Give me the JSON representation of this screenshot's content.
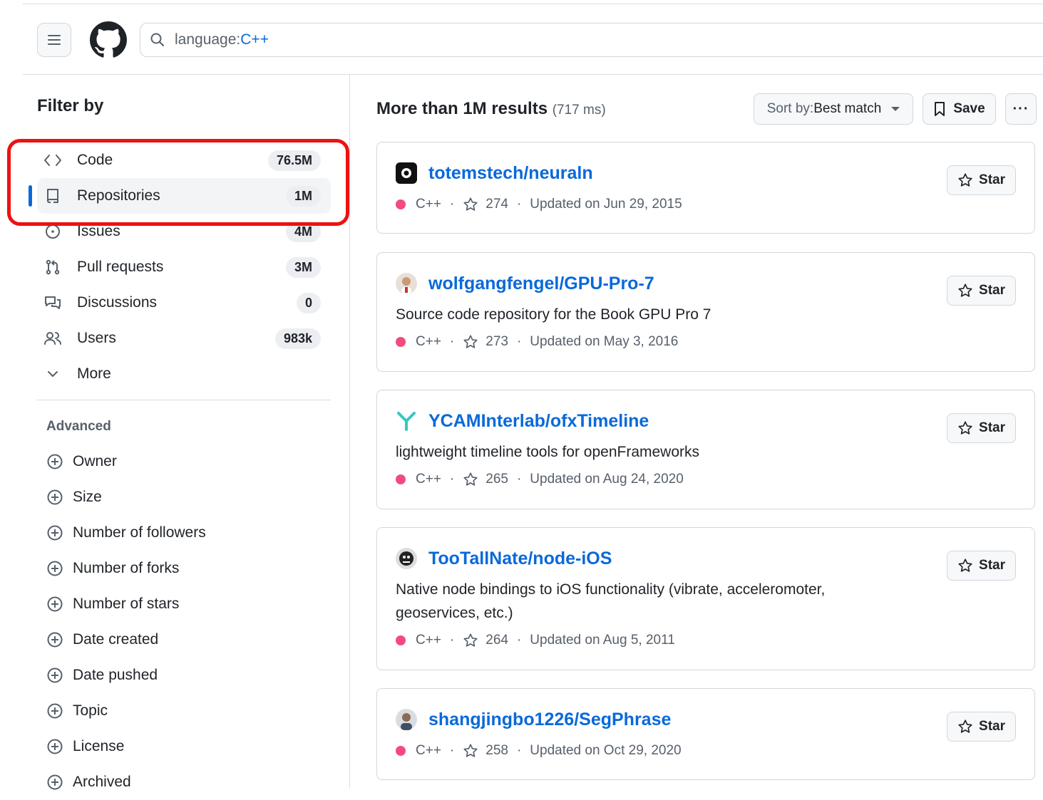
{
  "search": {
    "query_key": "language:",
    "query_value": "C++"
  },
  "sidebar": {
    "title": "Filter by",
    "items": [
      {
        "label": "Code",
        "count": "76.5M",
        "icon": "code-icon"
      },
      {
        "label": "Repositories",
        "count": "1M",
        "icon": "repo-icon",
        "selected": true
      },
      {
        "label": "Issues",
        "count": "4M",
        "icon": "issue-icon"
      },
      {
        "label": "Pull requests",
        "count": "3M",
        "icon": "pull-request-icon"
      },
      {
        "label": "Discussions",
        "count": "0",
        "icon": "discussion-icon"
      },
      {
        "label": "Users",
        "count": "983k",
        "icon": "people-icon"
      },
      {
        "label": "More",
        "icon": "chevron-down-icon"
      }
    ],
    "advanced_title": "Advanced",
    "advanced": [
      "Owner",
      "Size",
      "Number of followers",
      "Number of forks",
      "Number of stars",
      "Date created",
      "Date pushed",
      "Topic",
      "License",
      "Archived"
    ]
  },
  "results": {
    "title": "More than 1M results",
    "time": "(717 ms)",
    "sort_label": "Sort by:",
    "sort_value": "Best match",
    "save_label": "Save",
    "more_label": "···",
    "star_label": "Star",
    "language": "C++",
    "language_color": "#f34b7d",
    "items": [
      {
        "name": "totemstech/neuraln",
        "description": "",
        "stars": "274",
        "updated": "Updated on Jun 29, 2015"
      },
      {
        "name": "wolfgangfengel/GPU-Pro-7",
        "description": "Source code repository for the Book GPU Pro 7",
        "stars": "273",
        "updated": "Updated on May 3, 2016"
      },
      {
        "name": "YCAMInterlab/ofxTimeline",
        "description": "lightweight timeline tools for openFrameworks",
        "stars": "265",
        "updated": "Updated on Aug 24, 2020"
      },
      {
        "name": "TooTallNate/node-iOS",
        "description": "Native node bindings to iOS functionality (vibrate, acceleromoter, geoservices, etc.)",
        "stars": "264",
        "updated": "Updated on Aug 5, 2011"
      },
      {
        "name": "shangjingbo1226/SegPhrase",
        "description": "",
        "stars": "258",
        "updated": "Updated on Oct 29, 2020"
      }
    ]
  },
  "colors": {
    "accent": "#0969da",
    "highlight": "#ee1111"
  }
}
